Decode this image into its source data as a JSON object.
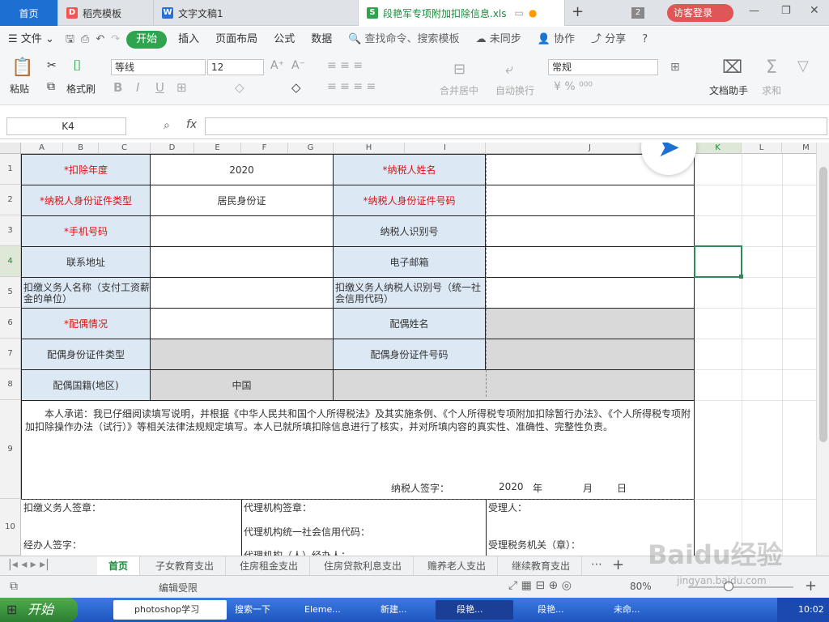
{
  "tabs": {
    "home": "首页",
    "t1": "稻壳模板",
    "t2": "文字文稿1",
    "t3": "段艳军专项附加扣除信息.xls",
    "count": "2",
    "login": "访客登录"
  },
  "menu": {
    "file": "文件",
    "start": "开始",
    "insert": "插入",
    "layout": "页面布局",
    "formula": "公式",
    "data": "数据",
    "search": "查找命令、搜索模板",
    "sync": "未同步",
    "collab": "协作",
    "share": "分享"
  },
  "ribbon": {
    "paste": "粘贴",
    "brush": "格式刷",
    "font": "等线",
    "size": "12",
    "merge": "合并居中",
    "wrap": "自动换行",
    "numfmt": "常规",
    "assistant": "文档助手",
    "sum": "求和",
    "filter": "筛选"
  },
  "formula": {
    "namebox": "K4",
    "fx": "fx",
    "value": ""
  },
  "columns": [
    "A",
    "B",
    "C",
    "D",
    "E",
    "F",
    "G",
    "H",
    "I",
    "J",
    "K",
    "L",
    "M"
  ],
  "rows": [
    "1",
    "2",
    "3",
    "4",
    "5",
    "6",
    "7",
    "8",
    "9",
    "10"
  ],
  "form": {
    "r1a": "*扣除年度",
    "r1b": "2020",
    "r1c": "*纳税人姓名",
    "r2a": "*纳税人身份证件类型",
    "r2b": "居民身份证",
    "r2c": "*纳税人身份证件号码",
    "r3a": "*手机号码",
    "r3c": "纳税人识别号",
    "r4a": "联系地址",
    "r4c": "电子邮箱",
    "r5a": "扣缴义务人名称（支付工资薪金的单位）",
    "r5c": "扣缴义务人纳税人识别号（统一社会信用代码）",
    "r6a": "*配偶情况",
    "r6c": "配偶姓名",
    "r7a": "配偶身份证件类型",
    "r7c": "配偶身份证件号码",
    "r8a": "配偶国籍(地区)",
    "r8b": "中国",
    "r9": "本人承诺：我已仔细阅读填写说明，并根据《中华人民共和国个人所得税法》及其实施条例、《个人所得税专项附加扣除暂行办法》、《个人所得税专项附加扣除操作办法（试行）》等相关法律法规规定填写。本人已就所填扣除信息进行了核实，并对所填内容的真实性、准确性、完整性负责。",
    "sign": "纳税人签字：",
    "year": "2020",
    "y": "年",
    "m": "月",
    "d": "日",
    "r10a1": "扣缴义务人签章：",
    "r10a2": "经办人签字：",
    "r10b1": "代理机构签章：",
    "r10b2": "代理机构统一社会信用代码：",
    "r10b3": "代理机构（人）经办人：",
    "r10c1": "受理人：",
    "r10c2": "受理税务机关（章）："
  },
  "sheets": [
    "首页",
    "子女教育支出",
    "住房租金支出",
    "住房贷款利息支出",
    "赡养老人支出",
    "继续教育支出"
  ],
  "status": {
    "edit": "编辑受限",
    "zoom": "80%"
  },
  "taskbar": {
    "start": "开始",
    "ie": "photoshop学习",
    "search": "搜索一下",
    "b1": "Eleme...",
    "b2": "新建...",
    "b3": "段艳...",
    "b4": "段艳...",
    "b5": "未命...",
    "time": "10:02"
  },
  "watermark": "Baidu经验",
  "watermark2": "jingyan.baidu.com"
}
